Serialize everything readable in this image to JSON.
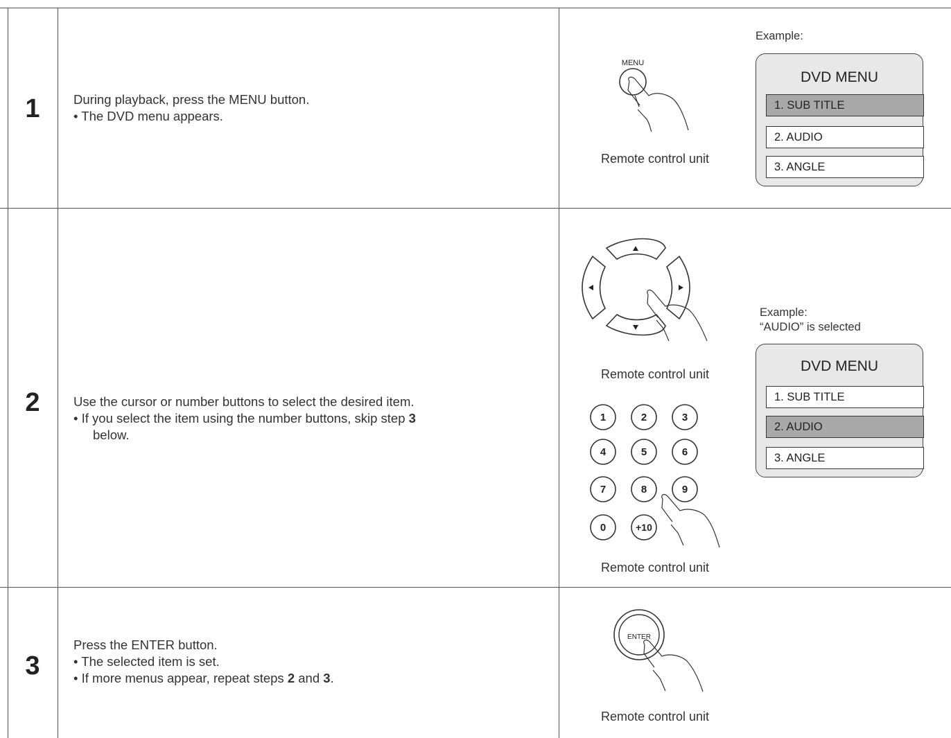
{
  "steps": [
    {
      "number": "1",
      "instruction": "During playback, press the MENU button.",
      "bullets": [
        "• The DVD menu appears."
      ],
      "remote_caption": "Remote control unit",
      "button_label": "MENU",
      "example_label": "Example:",
      "menu": {
        "title": "DVD MENU",
        "items": [
          "1. SUB TITLE",
          "2. AUDIO",
          "3. ANGLE"
        ],
        "selected_index": 0
      }
    },
    {
      "number": "2",
      "instruction": "Use the cursor or number buttons to select the desired item.",
      "bullet_prefix": "• If you select the item using the number buttons, skip step ",
      "bullet_bold": "3",
      "bullet_suffix": "below.",
      "remote_caption_cursor": "Remote control unit",
      "remote_caption_numbers": "Remote control unit",
      "number_buttons": [
        "1",
        "2",
        "3",
        "4",
        "5",
        "6",
        "7",
        "8",
        "9",
        "0",
        "+10"
      ],
      "example_label": "Example:",
      "example_note": "“AUDIO” is selected",
      "menu": {
        "title": "DVD MENU",
        "items": [
          "1. SUB TITLE",
          "2. AUDIO",
          "3. ANGLE"
        ],
        "selected_index": 1
      }
    },
    {
      "number": "3",
      "instruction": "Press the ENTER button.",
      "bullet1": "• The selected item is set.",
      "bullet2_prefix": "• If more menus appear, repeat steps ",
      "bullet2_bold1": "2",
      "bullet2_mid": " and ",
      "bullet2_bold2": "3",
      "bullet2_suffix": ".",
      "remote_caption": "Remote control unit",
      "button_label": "ENTER"
    }
  ]
}
